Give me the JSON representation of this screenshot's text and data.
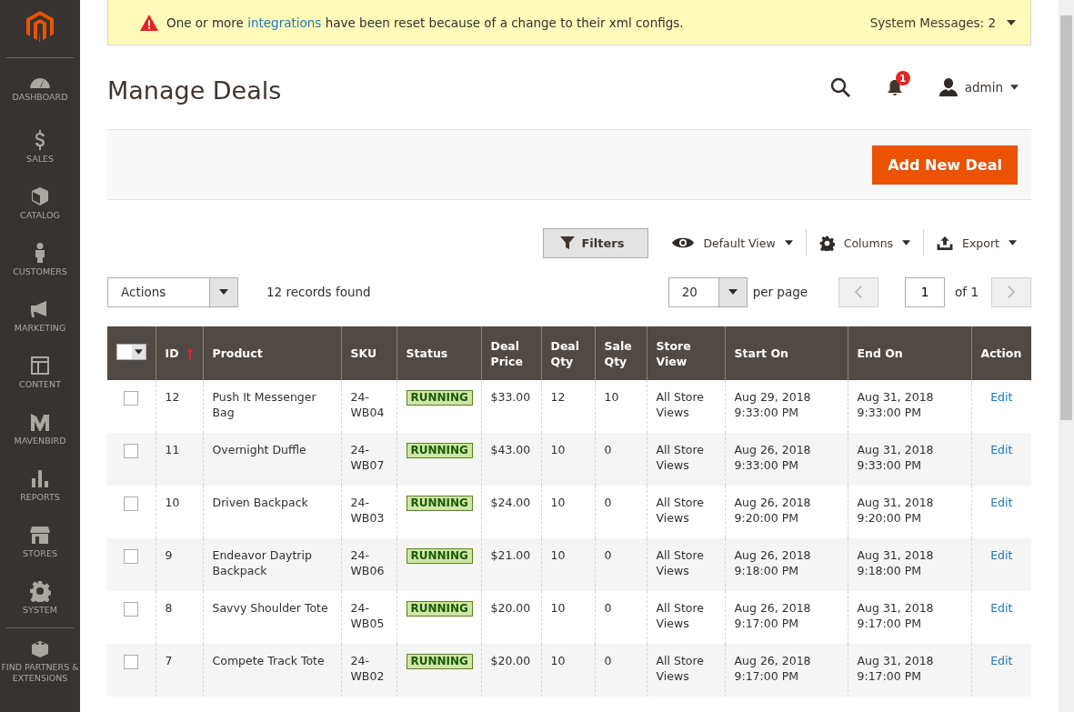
{
  "sidebar": {
    "items": [
      {
        "label": "DASHBOARD"
      },
      {
        "label": "SALES"
      },
      {
        "label": "CATALOG"
      },
      {
        "label": "CUSTOMERS"
      },
      {
        "label": "MARKETING"
      },
      {
        "label": "CONTENT"
      },
      {
        "label": "MAVENBIRD"
      },
      {
        "label": "REPORTS"
      },
      {
        "label": "STORES"
      },
      {
        "label": "SYSTEM"
      },
      {
        "label": "FIND PARTNERS & EXTENSIONS"
      }
    ]
  },
  "message_bar": {
    "before": "One or more ",
    "link": "integrations",
    "after": " have been reset because of a change to their xml configs.",
    "counter": "System Messages: 2"
  },
  "header": {
    "title": "Manage Deals",
    "notifications": "1",
    "user": "admin"
  },
  "add_button": "Add New Deal",
  "toolbar": {
    "filters": "Filters",
    "view": "Default View",
    "columns": "Columns",
    "export": "Export"
  },
  "grid_controls": {
    "actions": "Actions",
    "records": "12 records found",
    "per_page": "20",
    "per_page_label": "per page",
    "page": "1",
    "of_pages": "of 1"
  },
  "table": {
    "mass_select": {
      "checked": false
    },
    "columns": [
      {
        "label": "ID",
        "sorted": true
      },
      {
        "label": "Product",
        "sorted": false
      },
      {
        "label": "SKU",
        "sorted": false
      },
      {
        "label": "Status",
        "sorted": false
      },
      {
        "label": "Deal Price",
        "sorted": false
      },
      {
        "label": "Deal Qty",
        "sorted": false
      },
      {
        "label": "Sale Qty",
        "sorted": false
      },
      {
        "label": "Store View",
        "sorted": false
      },
      {
        "label": "Start On",
        "sorted": false
      },
      {
        "label": "End On",
        "sorted": false
      },
      {
        "label": "Action",
        "sorted": false
      }
    ],
    "rows": [
      {
        "checked": false,
        "id": "12",
        "product": "Push It Messenger Bag",
        "sku": "24-WB04",
        "status": {
          "label": "RUNNING",
          "kind": "running"
        },
        "price": "$33.00",
        "deal_qty": "12",
        "sale_qty": "10",
        "store_view": "All Store Views",
        "start": "Aug 29, 2018 9:33:00 PM",
        "end": "Aug 31, 2018 9:33:00 PM",
        "action": "Edit"
      },
      {
        "checked": false,
        "id": "11",
        "product": "Overnight Duffle",
        "sku": "24-WB07",
        "status": {
          "label": "RUNNING",
          "kind": "running"
        },
        "price": "$43.00",
        "deal_qty": "10",
        "sale_qty": "0",
        "store_view": "All Store Views",
        "start": "Aug 26, 2018 9:33:00 PM",
        "end": "Aug 31, 2018 9:33:00 PM",
        "action": "Edit"
      },
      {
        "checked": false,
        "id": "10",
        "product": "Driven Backpack",
        "sku": "24-WB03",
        "status": {
          "label": "RUNNING",
          "kind": "running"
        },
        "price": "$24.00",
        "deal_qty": "10",
        "sale_qty": "0",
        "store_view": "All Store Views",
        "start": "Aug 26, 2018 9:20:00 PM",
        "end": "Aug 31, 2018 9:20:00 PM",
        "action": "Edit"
      },
      {
        "checked": false,
        "id": "9",
        "product": "Endeavor Daytrip Backpack",
        "sku": "24-WB06",
        "status": {
          "label": "RUNNING",
          "kind": "running"
        },
        "price": "$21.00",
        "deal_qty": "10",
        "sale_qty": "0",
        "store_view": "All Store Views",
        "start": "Aug 26, 2018 9:18:00 PM",
        "end": "Aug 31, 2018 9:18:00 PM",
        "action": "Edit"
      },
      {
        "checked": false,
        "id": "8",
        "product": "Savvy Shoulder Tote",
        "sku": "24-WB05",
        "status": {
          "label": "RUNNING",
          "kind": "running"
        },
        "price": "$20.00",
        "deal_qty": "10",
        "sale_qty": "0",
        "store_view": "All Store Views",
        "start": "Aug 26, 2018 9:17:00 PM",
        "end": "Aug 31, 2018 9:17:00 PM",
        "action": "Edit"
      },
      {
        "checked": false,
        "id": "7",
        "product": "Compete Track Tote",
        "sku": "24-WB02",
        "status": {
          "label": "RUNNING",
          "kind": "running"
        },
        "price": "$20.00",
        "deal_qty": "10",
        "sale_qty": "0",
        "store_view": "All Store Views",
        "start": "Aug 26, 2018 9:17:00 PM",
        "end": "Aug 31, 2018 9:17:00 PM",
        "action": "Edit"
      }
    ]
  }
}
